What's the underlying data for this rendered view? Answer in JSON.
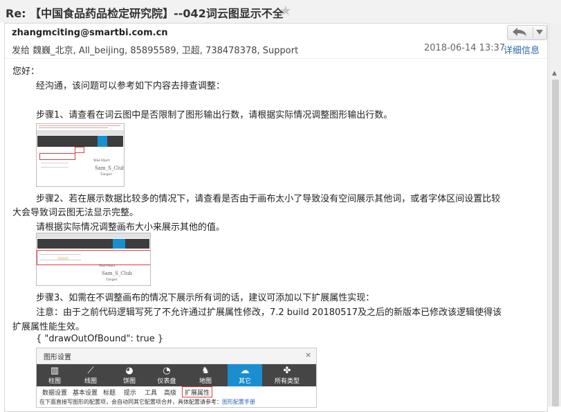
{
  "email": {
    "subject": "Re: 【中国食品药品检定研究院】--042词云图显示不全",
    "from": "zhangmciting@smartbi.com.cn",
    "to_label": "发给",
    "to": "魏巍_北京, All_beijing, 85895589, 卫超, 738478378, Support",
    "date": "2018-06-14 13:37",
    "detail_link": "详细信息",
    "icons": [
      "star-icon",
      "reply-icon",
      "chevron-down-icon"
    ]
  },
  "body": {
    "greeting": "您好：",
    "intro": "经沟通，该问题可以参考如下内容去排查调整：",
    "step1": "步骤1、请查看在词云图中是否限制了图形输出行数，请根据实际情况调整图形输出行数。",
    "step2_line1": "步骤2、若在展示数据比较多的情况下，请查看是否由于画布太小了导致没有空间展示其他词，或者字体区间设置比较",
    "step2_line2": "大会导致词云图无法显示完整。",
    "step2_line3": "请根据实际情况调整画布大小来展示其他的值。",
    "step3_line1": "步骤3、如需在不调整画布的情况下展示所有词的话，建议可添加以下扩展属性实现：",
    "note_line1": "注意：由于之前代码逻辑写死了不允许通过扩展属性修改，7.2 build 20180517及之后的新版本已修改该逻辑使得该",
    "note_line2": "扩展属性能生效。",
    "code": "{ \"drawOutOfBound\": true }"
  },
  "screenshot1": {
    "wordcloud": "Sam_S_Club"
  },
  "screenshot2": {
    "wordcloud": "Sam_S_Club"
  },
  "dialog": {
    "title": "图形设置",
    "close": "×",
    "chart_types": [
      {
        "label": "柱图",
        "icon": "bar-chart-icon"
      },
      {
        "label": "线图",
        "icon": "line-chart-icon"
      },
      {
        "label": "饼图",
        "icon": "pie-chart-icon"
      },
      {
        "label": "仪表盘",
        "icon": "gauge-icon"
      },
      {
        "label": "地图",
        "icon": "map-icon"
      },
      {
        "label": "其它",
        "icon": "other-icon"
      },
      {
        "label": "所有类型",
        "icon": "all-types-icon"
      }
    ],
    "tabs": [
      "数据设置",
      "基本设置",
      "标题",
      "提示",
      "工具",
      "高级",
      "扩展属性"
    ],
    "note_text": "在下面直接写图形的配置项，会自动同其它配置项合并，具体配置请参考：",
    "note_link": "图形配置手册"
  }
}
